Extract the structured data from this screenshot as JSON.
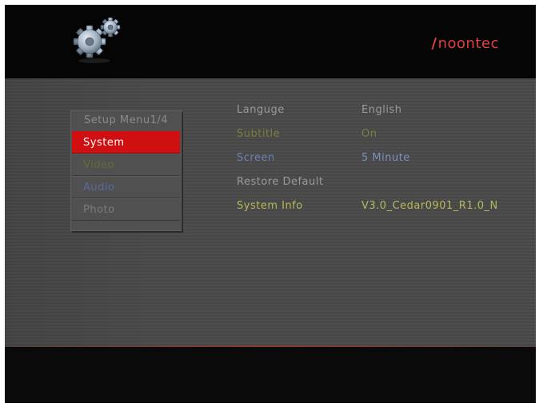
{
  "brand": {
    "name": "noontec",
    "slash": "/"
  },
  "menu": {
    "title": "Setup Menu1/4",
    "items": [
      {
        "label": "System",
        "selected": true
      },
      {
        "label": "Video"
      },
      {
        "label": "Audio"
      },
      {
        "label": "Photo"
      }
    ]
  },
  "settings": [
    {
      "label": "Languge",
      "value": "English"
    },
    {
      "label": "Subtitle",
      "value": "On"
    },
    {
      "label": "Screen",
      "value": "5 Minute"
    },
    {
      "label": "Restore Default",
      "value": ""
    },
    {
      "label": "System Info",
      "value": "V3.0_Cedar0901_R1.0_N"
    }
  ],
  "colors": {
    "selected_bg": "#d01010",
    "brand": "#e0413f"
  },
  "icons": {
    "logo": "gears-icon"
  }
}
